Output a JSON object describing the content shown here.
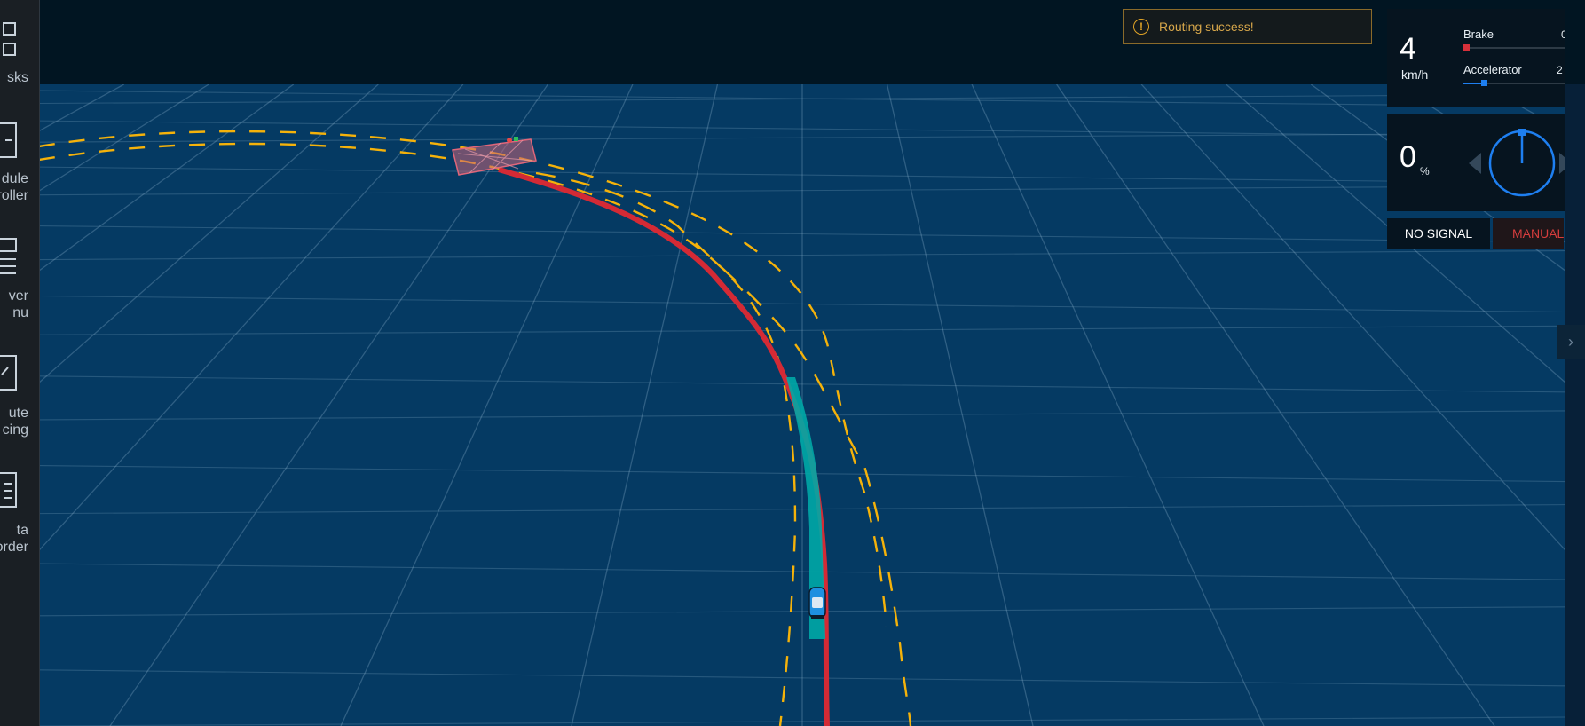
{
  "sidebar": {
    "items": [
      {
        "label": "Tasks",
        "visible_text": "sks",
        "icon": "tasks-icon"
      },
      {
        "label_lines": [
          "dule",
          "roller"
        ],
        "icon": "module-controller-icon"
      },
      {
        "label_lines": [
          "ver",
          "nu"
        ],
        "icon": "layer-menu-icon"
      },
      {
        "label_lines": [
          "ute",
          "cing"
        ],
        "icon": "route-editing-icon"
      },
      {
        "label_lines": [
          "ta",
          "order"
        ],
        "icon": "data-recorder-icon"
      }
    ]
  },
  "notification": {
    "text": "Routing success!",
    "icon": "warning-icon",
    "color": "#e0a326"
  },
  "dashboard": {
    "speed": {
      "value": "4",
      "unit": "km/h"
    },
    "brake": {
      "label": "Brake",
      "value_visible": "0",
      "percent": 1,
      "color": "#d6303a"
    },
    "accelerator": {
      "label": "Accelerator",
      "value_visible": "2",
      "percent": 20,
      "color": "#1e7ff0"
    },
    "steering": {
      "value": "0",
      "unit": "%",
      "angle_deg": 0,
      "color": "#1e7ff0"
    },
    "signal": {
      "label": "NO SIGNAL"
    },
    "driving_mode": {
      "label": "MANUAL",
      "color": "#d63d3d"
    }
  },
  "scene": {
    "background_color": "#053a63",
    "grid_color": "#9fc3db",
    "lane_color": "#f5b20a",
    "routing_color": "#d42a35",
    "planning_color": "#00a9a6",
    "car_color": "#1e90e0",
    "obstacle_color": "#e0667a"
  },
  "toggle_icon": "chevron-right-icon"
}
